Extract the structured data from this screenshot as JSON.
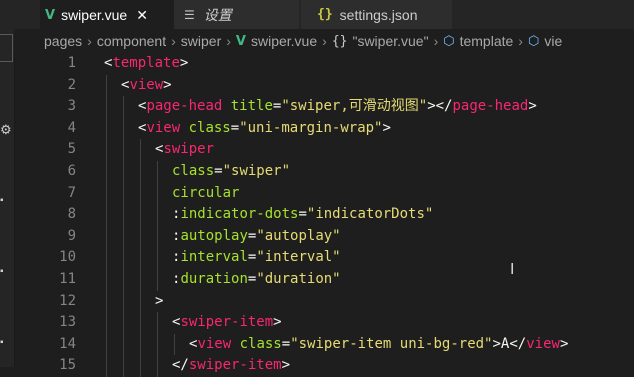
{
  "tabs": [
    {
      "icon": "vue-icon",
      "label": "swiper.vue",
      "active": true
    },
    {
      "icon": "settings-icon",
      "label": "设置"
    },
    {
      "icon": "json-icon",
      "label": "settings.json"
    }
  ],
  "breadcrumb": [
    "pages",
    "component",
    "swiper",
    "swiper.vue",
    "\"swiper.vue\"",
    "template",
    "vie"
  ],
  "code": {
    "lines": [
      {
        "n": "1",
        "indent": 0,
        "tokens": [
          [
            "punct",
            "<"
          ],
          [
            "tag",
            "template"
          ],
          [
            "punct",
            ">"
          ]
        ]
      },
      {
        "n": "2",
        "indent": 1,
        "tokens": [
          [
            "punct",
            "<"
          ],
          [
            "tag",
            "view"
          ],
          [
            "punct",
            ">"
          ]
        ]
      },
      {
        "n": "3",
        "indent": 2,
        "tokens": [
          [
            "punct",
            "<"
          ],
          [
            "tag",
            "page-head"
          ],
          [
            "txt",
            " "
          ],
          [
            "attr",
            "title"
          ],
          [
            "punct",
            "="
          ],
          [
            "str",
            "\"swiper,可滑动视图\""
          ],
          [
            "punct",
            "></"
          ],
          [
            "tag",
            "page-head"
          ],
          [
            "punct",
            ">"
          ]
        ]
      },
      {
        "n": "4",
        "indent": 2,
        "tokens": [
          [
            "punct",
            "<"
          ],
          [
            "tag",
            "view"
          ],
          [
            "txt",
            " "
          ],
          [
            "attr",
            "class"
          ],
          [
            "punct",
            "="
          ],
          [
            "str",
            "\"uni-margin-wrap\""
          ],
          [
            "punct",
            ">"
          ]
        ]
      },
      {
        "n": "5",
        "indent": 3,
        "tokens": [
          [
            "punct",
            "<"
          ],
          [
            "tag",
            "swiper"
          ]
        ]
      },
      {
        "n": "6",
        "indent": 4,
        "tokens": [
          [
            "attr",
            "class"
          ],
          [
            "punct",
            "="
          ],
          [
            "str",
            "\"swiper\""
          ]
        ]
      },
      {
        "n": "7",
        "indent": 4,
        "tokens": [
          [
            "attr",
            "circular"
          ]
        ]
      },
      {
        "n": "8",
        "indent": 4,
        "tokens": [
          [
            "txt",
            ":"
          ],
          [
            "attr",
            "indicator-dots"
          ],
          [
            "punct",
            "="
          ],
          [
            "str",
            "\"indicatorDots\""
          ]
        ]
      },
      {
        "n": "9",
        "indent": 4,
        "tokens": [
          [
            "txt",
            ":"
          ],
          [
            "attr",
            "autoplay"
          ],
          [
            "punct",
            "="
          ],
          [
            "str",
            "\"autoplay\""
          ]
        ]
      },
      {
        "n": "10",
        "indent": 4,
        "tokens": [
          [
            "txt",
            ":"
          ],
          [
            "attr",
            "interval"
          ],
          [
            "punct",
            "="
          ],
          [
            "str",
            "\"interval\""
          ]
        ]
      },
      {
        "n": "11",
        "indent": 4,
        "tokens": [
          [
            "txt",
            ":"
          ],
          [
            "attr",
            "duration"
          ],
          [
            "punct",
            "="
          ],
          [
            "str",
            "\"duration\""
          ]
        ]
      },
      {
        "n": "12",
        "indent": 3,
        "tokens": [
          [
            "punct",
            ">"
          ]
        ]
      },
      {
        "n": "13",
        "indent": 4,
        "tokens": [
          [
            "punct",
            "<"
          ],
          [
            "tag",
            "swiper-item"
          ],
          [
            "punct",
            ">"
          ]
        ]
      },
      {
        "n": "14",
        "indent": 5,
        "tokens": [
          [
            "punct",
            "<"
          ],
          [
            "tag",
            "view"
          ],
          [
            "txt",
            " "
          ],
          [
            "attr",
            "class"
          ],
          [
            "punct",
            "="
          ],
          [
            "str",
            "\"swiper-item uni-bg-red\""
          ],
          [
            "punct",
            ">"
          ],
          [
            "txt",
            "A"
          ],
          [
            "punct",
            "</"
          ],
          [
            "tag",
            "view"
          ],
          [
            "punct",
            ">"
          ]
        ]
      },
      {
        "n": "15",
        "indent": 4,
        "tokens": [
          [
            "punct",
            "</"
          ],
          [
            "tag",
            "swiper-item"
          ],
          [
            "punct",
            ">"
          ]
        ]
      }
    ]
  },
  "colors": {
    "background": "#1e1e1e",
    "tag": "#f92672",
    "attribute": "#a6e22e",
    "string": "#e6db74",
    "vue": "#41b883"
  }
}
